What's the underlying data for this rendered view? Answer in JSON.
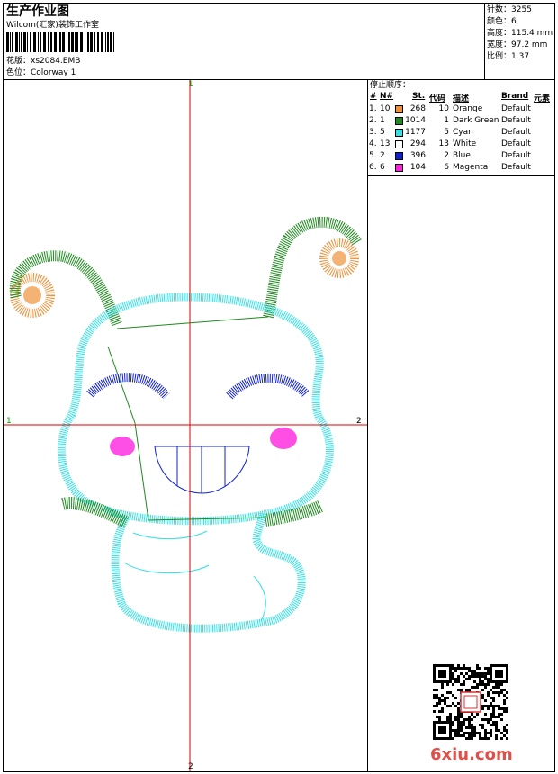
{
  "header": {
    "title": "生产作业图",
    "company": "Wilcom(汇家)装饰工作室",
    "design_label": "花版：",
    "design_file": "xs2084.EMB",
    "colorway_label": "色位：",
    "colorway": "Colorway 1"
  },
  "stats": {
    "stitches_label": "针数：",
    "stitches": "3255",
    "colors_label": "颜色：",
    "colors": "6",
    "height_label": "高度：",
    "height": "115.4 mm",
    "width_label": "宽度：",
    "width": "97.2 mm",
    "ratio_label": "比例：",
    "ratio": "1.37"
  },
  "stop_sequence": {
    "title": "停止顺序：",
    "headers": [
      "#",
      "N#",
      "St.",
      "代码",
      "描述",
      "Brand",
      "元素"
    ],
    "rows": [
      {
        "idx": "1.",
        "n": "10",
        "st": "268",
        "code": "10",
        "desc": "Orange",
        "brand": "Default",
        "color": "#f0913a"
      },
      {
        "idx": "2.",
        "n": "1",
        "st": "1014",
        "code": "1",
        "desc": "Dark Green",
        "brand": "Default",
        "color": "#1e8a1e"
      },
      {
        "idx": "3.",
        "n": "5",
        "st": "1177",
        "code": "5",
        "desc": "Cyan",
        "brand": "Default",
        "color": "#33e0e6"
      },
      {
        "idx": "4.",
        "n": "13",
        "st": "294",
        "code": "13",
        "desc": "White",
        "brand": "Default",
        "color": "#ffffff"
      },
      {
        "idx": "5.",
        "n": "2",
        "st": "396",
        "code": "2",
        "desc": "Blue",
        "brand": "Default",
        "color": "#1020cc"
      },
      {
        "idx": "6.",
        "n": "6",
        "st": "104",
        "code": "6",
        "desc": "Magenta",
        "brand": "Default",
        "color": "#ff22dd"
      }
    ]
  },
  "axes": {
    "top": "1",
    "bottom": "2",
    "left": "1",
    "right": "2"
  },
  "watermark": {
    "text": "6xiu.com"
  }
}
